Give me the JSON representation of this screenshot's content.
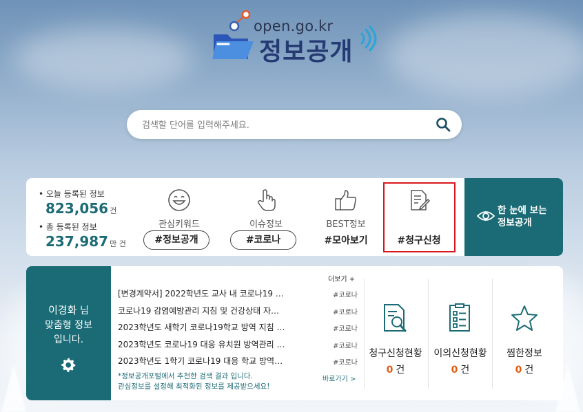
{
  "logo": {
    "domain": "open.go.kr",
    "name": "정보공개"
  },
  "search": {
    "placeholder": "검색할 단어를 입력해주세요."
  },
  "stats": {
    "today_label": "• 오늘 등록된 정보",
    "today_value": "823,056",
    "today_unit": "건",
    "total_label": "• 총 등록된 정보",
    "total_value": "237,987",
    "total_unit": "만 건"
  },
  "features": [
    {
      "label": "관심키워드",
      "tag": "#정보공개",
      "icon": "smile-icon"
    },
    {
      "label": "이슈정보",
      "tag": "#코로나",
      "icon": "hand-pointer-icon"
    },
    {
      "label": "BEST정보",
      "tag": "#모아보기",
      "icon": "thumbs-up-icon"
    },
    {
      "label": "",
      "tag": "#청구신청",
      "icon": "document-edit-icon"
    }
  ],
  "oneview": {
    "line1": "한 눈에 보는",
    "line2": "정보공개",
    "icon": "eye-icon"
  },
  "profile": {
    "name": "이경화",
    "suffix": " 님",
    "line2": "맞춤형 정보",
    "line3": "입니다.",
    "icon": "gear-icon"
  },
  "recommend": {
    "more": "더보기 +",
    "items": [
      {
        "title": "[변경계약서] 2022학년도 교사 내 코로나19 …",
        "tag": "#코로나"
      },
      {
        "title": "코로나19 감염예방관리 지침 및 건강상태 자…",
        "tag": "#코로나"
      },
      {
        "title": "2023학년도 새학기 코로나19학교 방역 지침 …",
        "tag": "#코로나"
      },
      {
        "title": "2023학년도 코로나19 대응 유치원 방역관리 …",
        "tag": "#코로나"
      },
      {
        "title": "2023학년도 1학기 코로나19 대응 학교 방역…",
        "tag": "#코로나"
      }
    ],
    "note1": "*정보공개포털에서 추천한 검색 결과 입니다.",
    "note2": "관심정보를 설정해 최적화된 정보를 제공받으세요!",
    "goto": "바로가기 >"
  },
  "summary": [
    {
      "label": "청구신청현황",
      "count": "0",
      "unit": "건",
      "icon": "document-search-icon"
    },
    {
      "label": "이의신청현황",
      "count": "0",
      "unit": "건",
      "icon": "checklist-icon"
    },
    {
      "label": "찜한정보",
      "count": "0",
      "unit": "건",
      "icon": "star-icon"
    }
  ],
  "colors": {
    "teal": "#1a6b75",
    "highlight": "#d9161d",
    "count": "#e05a10"
  }
}
